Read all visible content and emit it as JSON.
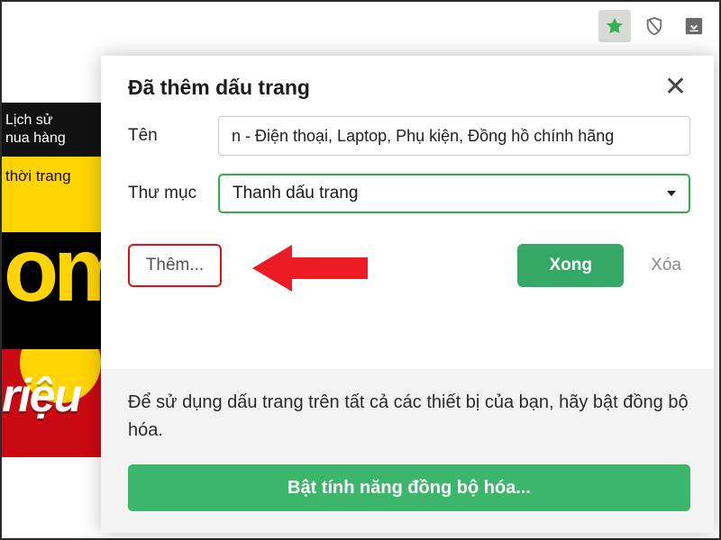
{
  "toolbar": {
    "star_active": true
  },
  "background": {
    "history_tab": "Lịch sử\nnua hàng",
    "fashion_tab": "thời trang"
  },
  "popup": {
    "title": "Đã thêm dấu trang",
    "name_label": "Tên",
    "name_value": "n - Điện thoại, Laptop, Phụ kiện, Đồng hồ chính hãng",
    "folder_label": "Thư mục",
    "folder_value": "Thanh dấu trang",
    "more_button": "Thêm...",
    "done_button": "Xong",
    "delete_button": "Xóa",
    "sync_text": "Để sử dụng dấu trang trên tất cả các thiết bị của bạn, hãy bật đồng bộ hóa.",
    "sync_button": "Bật tính năng đồng bộ hóa..."
  }
}
